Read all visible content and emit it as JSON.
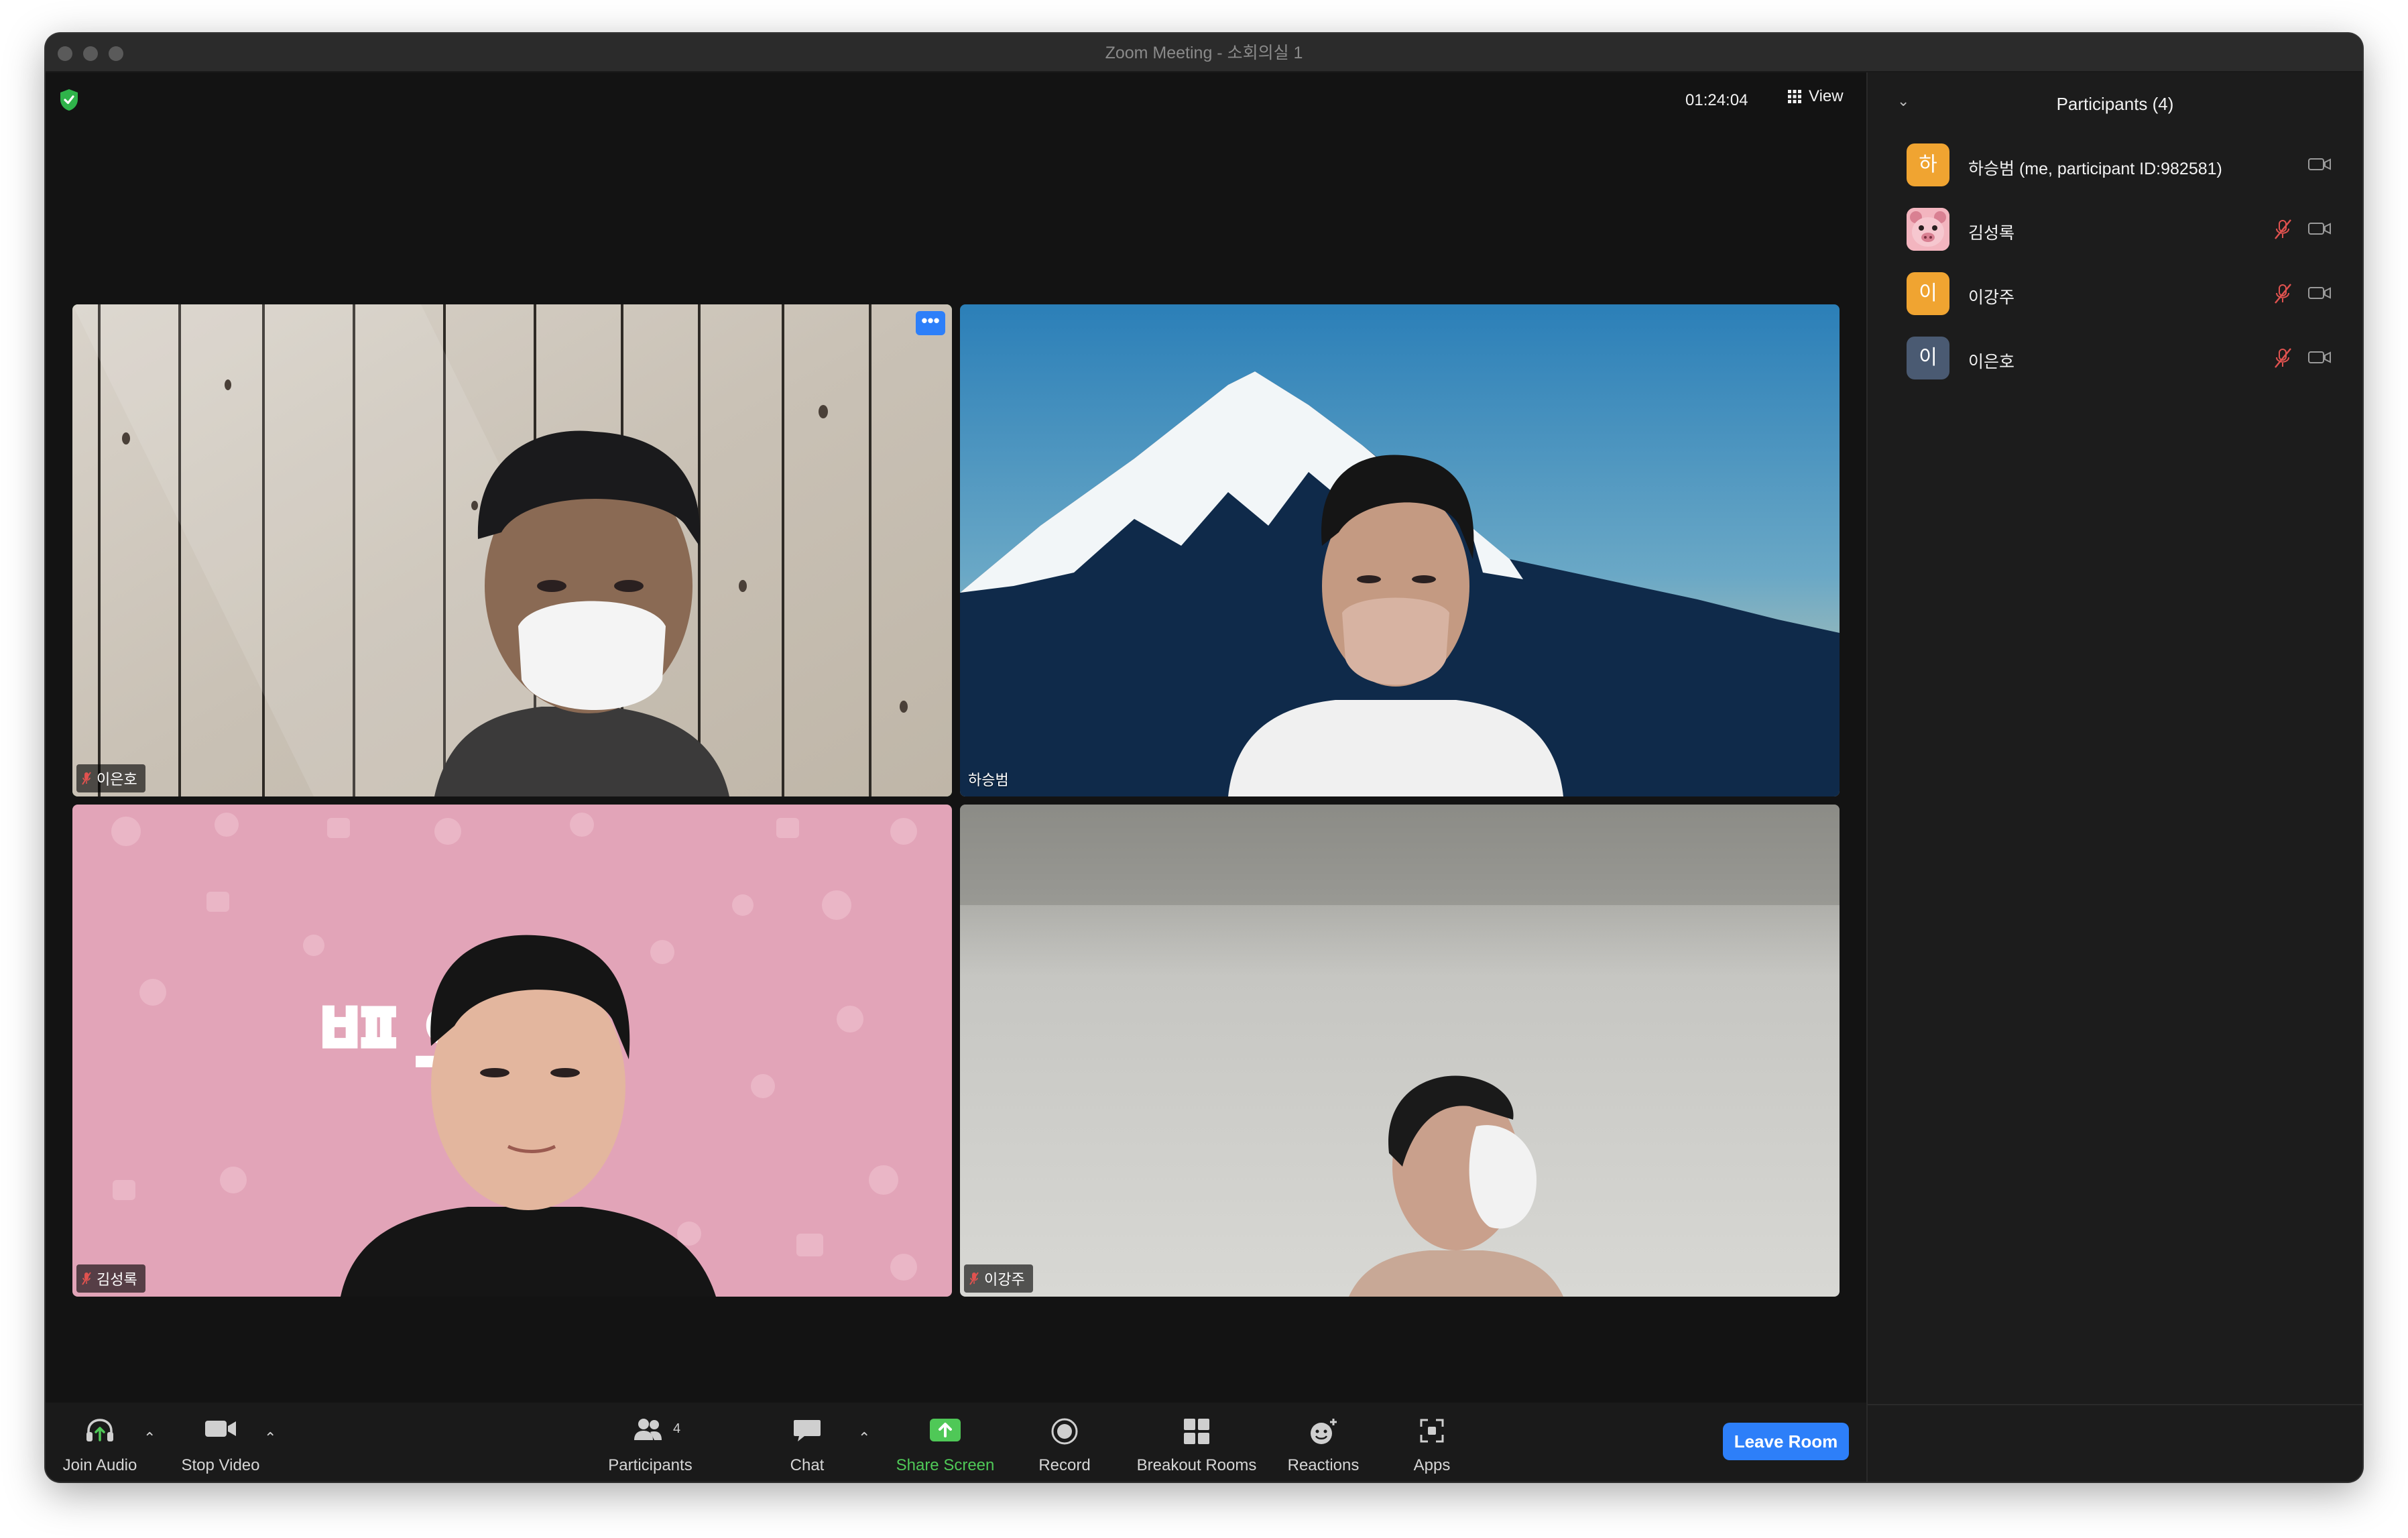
{
  "window": {
    "title": "Zoom Meeting - 소회의실 1"
  },
  "meeting": {
    "timer": "01:24:04",
    "view_label": "View"
  },
  "tiles": [
    {
      "name": "이은호",
      "muted": true,
      "active_speaker": true
    },
    {
      "name": "하승범",
      "muted": false
    },
    {
      "name": "김성록",
      "muted": true,
      "overlay_text": "ᄪ우"
    },
    {
      "name": "이강주",
      "muted": true
    }
  ],
  "toolbar": {
    "join_audio": "Join Audio",
    "stop_video": "Stop Video",
    "participants": "Participants",
    "participants_count": "4",
    "chat": "Chat",
    "share_screen": "Share Screen",
    "record": "Record",
    "breakout_rooms": "Breakout Rooms",
    "reactions": "Reactions",
    "apps": "Apps",
    "leave_room": "Leave Room"
  },
  "panel": {
    "title": "Participants (4)",
    "participants": [
      {
        "initial": "하",
        "name": "하승범 (me, participant ID:982581)",
        "avatar_color": "#f0a431",
        "muted": false
      },
      {
        "initial": "",
        "name": "김성록",
        "avatar_color": "#e8a0a8",
        "muted": true
      },
      {
        "initial": "이",
        "name": "이강주",
        "avatar_color": "#f0a431",
        "muted": true
      },
      {
        "initial": "이",
        "name": "이은호",
        "avatar_color": "#4a5a72",
        "muted": true
      }
    ]
  },
  "colors": {
    "accent": "#2d7ff9",
    "speaker_border": "#6fd36a",
    "share_green": "#4fc857",
    "mute_red": "#e0524f"
  }
}
